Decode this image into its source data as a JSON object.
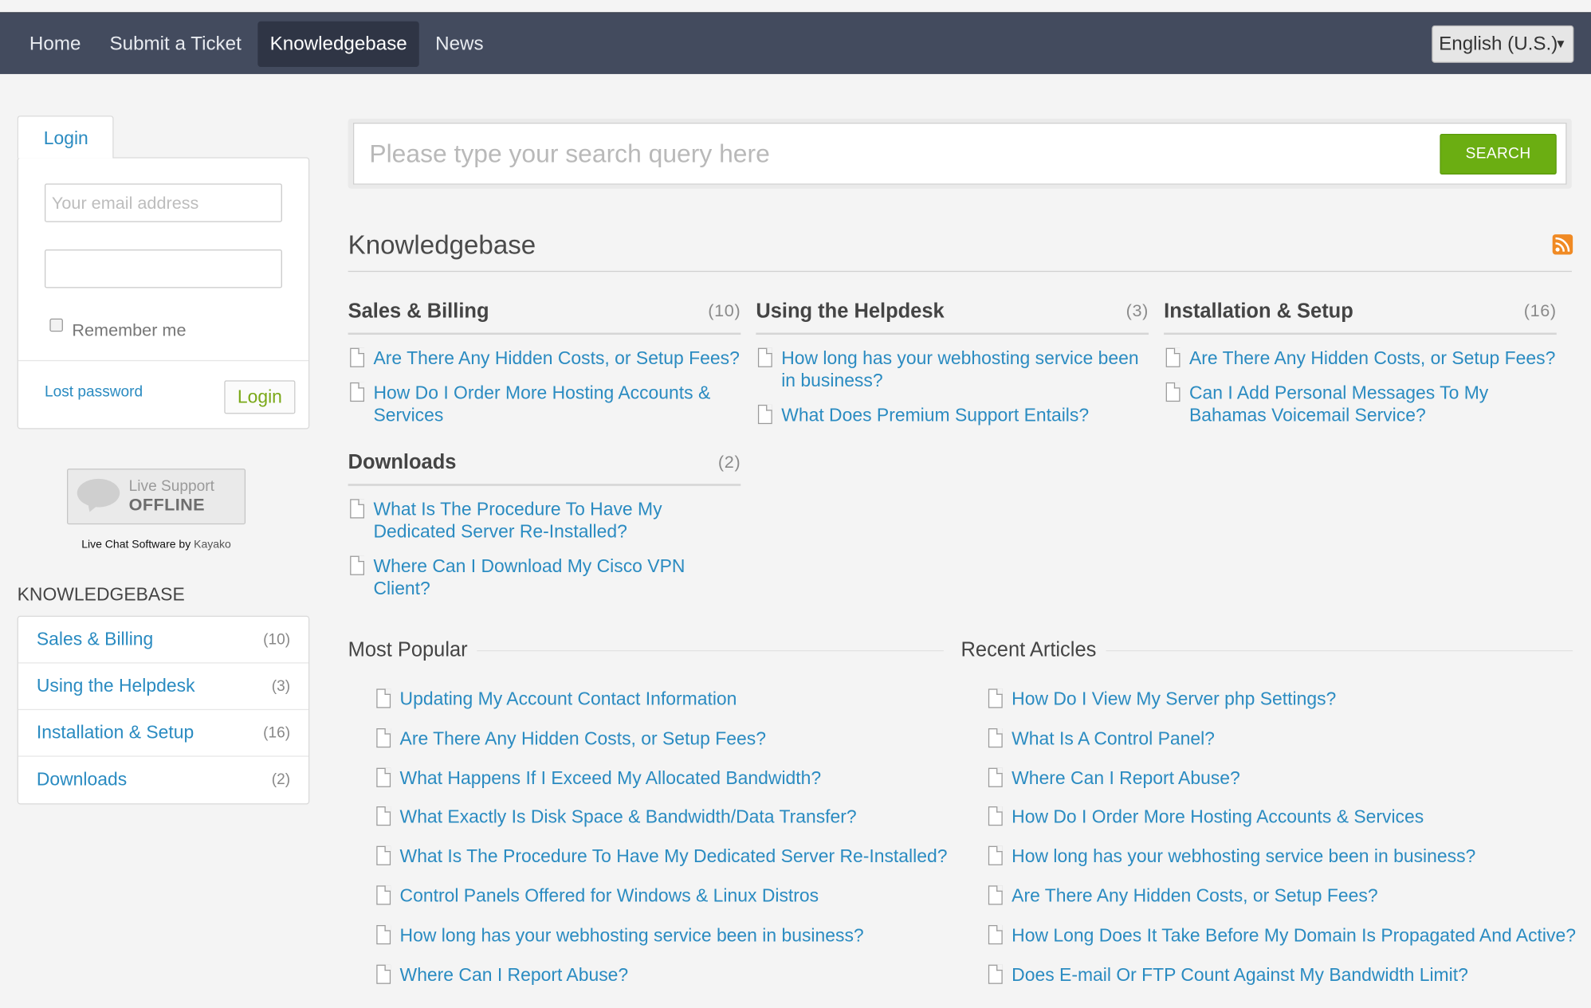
{
  "nav": {
    "items": [
      "Home",
      "Submit a Ticket",
      "Knowledgebase",
      "News"
    ],
    "active": "Knowledgebase",
    "language": "English (U.S.)"
  },
  "login": {
    "tab_label": "Login",
    "email_placeholder": "Your email address",
    "password_value": "",
    "remember_label": "Remember me",
    "lost_password": "Lost password",
    "login_button": "Login"
  },
  "live_support": {
    "line1": "Live Support",
    "line2": "OFFLINE",
    "credit_text": "Live Chat Software by",
    "credit_link": "Kayako"
  },
  "sidebar": {
    "heading": "KNOWLEDGEBASE",
    "items": [
      {
        "label": "Sales & Billing",
        "count": "(10)"
      },
      {
        "label": "Using the Helpdesk",
        "count": "(3)"
      },
      {
        "label": "Installation & Setup",
        "count": "(16)"
      },
      {
        "label": "Downloads",
        "count": "(2)"
      }
    ]
  },
  "search": {
    "placeholder": "Please type your search query here",
    "button": "SEARCH"
  },
  "kb": {
    "title": "Knowledgebase",
    "rss_icon": "rss-icon",
    "categories": [
      {
        "title": "Sales & Billing",
        "count": "(10)",
        "articles": [
          "Are There Any Hidden Costs, or Setup Fees?",
          "How Do I Order More Hosting Accounts & Services"
        ]
      },
      {
        "title": "Using the Helpdesk",
        "count": "(3)",
        "articles": [
          "How long has your webhosting service been in business?",
          "What Does Premium Support Entails?"
        ]
      },
      {
        "title": "Installation & Setup",
        "count": "(16)",
        "articles": [
          "Are There Any Hidden Costs, or Setup Fees?",
          "Can I Add Personal Messages To My Bahamas Voicemail Service?"
        ]
      },
      {
        "title": "Downloads",
        "count": "(2)",
        "articles": [
          "What Is The Procedure To Have My Dedicated Server Re-Installed?",
          "Where Can I Download My Cisco VPN Client?"
        ]
      }
    ]
  },
  "popular": {
    "heading": "Most Popular",
    "articles": [
      "Updating My Account Contact Information",
      "Are There Any Hidden Costs, or Setup Fees?",
      "What Happens If I Exceed My Allocated Bandwidth?",
      "What Exactly Is Disk Space & Bandwidth/Data Transfer?",
      "What Is The Procedure To Have My Dedicated Server Re-Installed?",
      "Control Panels Offered for Windows & Linux Distros",
      "How long has your webhosting service been in business?",
      "Where Can I Report Abuse?"
    ]
  },
  "recent": {
    "heading": "Recent Articles",
    "articles": [
      "How Do I View My Server php Settings?",
      "What Is A Control Panel?",
      "Where Can I Report Abuse?",
      "How Do I Order More Hosting Accounts & Services",
      "How long has your webhosting service been in business?",
      "Are There Any Hidden Costs, or Setup Fees?",
      "How Long Does It Take Before My Domain Is Propagated And Active?",
      "Does E-mail Or FTP Count Against My Bandwidth Limit?"
    ]
  }
}
